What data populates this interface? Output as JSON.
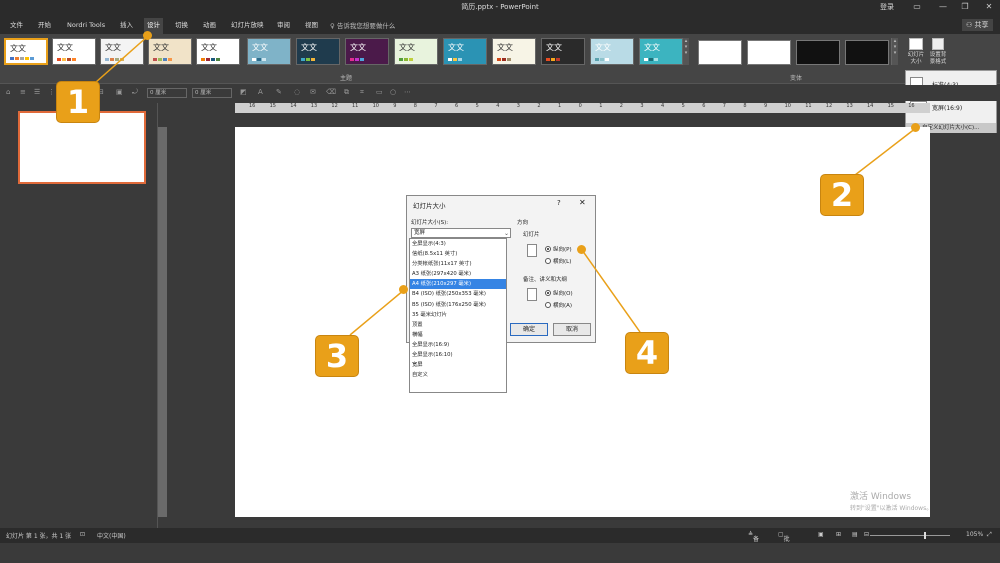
{
  "window": {
    "title": "简历.pptx - PowerPoint",
    "login": "登录"
  },
  "tabs": [
    {
      "label": "文件"
    },
    {
      "label": "开始"
    },
    {
      "label": "Nordri Tools"
    },
    {
      "label": "插入"
    },
    {
      "label": "设计"
    },
    {
      "label": "切换"
    },
    {
      "label": "动画"
    },
    {
      "label": "幻灯片放映"
    },
    {
      "label": "审阅"
    },
    {
      "label": "视图"
    }
  ],
  "tell_me": "告诉我您想要做什么",
  "share_label": "共享",
  "ribbon": {
    "theme_text": "文文",
    "themes_group_label": "主题",
    "variants_group_label": "变体",
    "slide_size_label": "幻灯片大小",
    "format_bg_label": "设置背景格式"
  },
  "size_menu": {
    "standard": "标准(4:3)",
    "wide": "宽屏(16:9)",
    "custom": "自定义幻灯片大小(C)..."
  },
  "toolbar": {
    "box1": "0 厘米",
    "box2": "0 厘米"
  },
  "ruler": [
    "16",
    "15",
    "14",
    "13",
    "12",
    "11",
    "10",
    "9",
    "8",
    "7",
    "6",
    "5",
    "4",
    "3",
    "2",
    "1",
    "0",
    "1",
    "2",
    "3",
    "4",
    "5",
    "6",
    "7",
    "8",
    "9",
    "10",
    "11",
    "12",
    "13",
    "14",
    "15",
    "16"
  ],
  "dialog": {
    "title": "幻灯片大小",
    "help": "?",
    "close": "✕",
    "size_label": "幻灯片大小(S):",
    "size_value": "宽屏",
    "orientation_label": "方向",
    "slide_label": "幻灯片",
    "portrait": "纵向(P)",
    "landscape": "横向(L)",
    "notes_label": "备注、讲义和大纲",
    "notes_portrait": "纵向(O)",
    "notes_landscape": "横向(A)",
    "ok": "确定",
    "cancel": "取消"
  },
  "size_options": [
    "全屏显示(4:3)",
    "信纸(8.5x11 英寸)",
    "分类帐纸张(11x17 英寸)",
    "A3 纸张(297x420 毫米)",
    "A4 纸张(210x297 毫米)",
    "B4 (ISO) 纸张(250x353 毫米)",
    "B5 (ISO) 纸张(176x250 毫米)",
    "35 毫米幻灯片",
    "顶置",
    "横幅",
    "全屏显示(16:9)",
    "全屏显示(16:10)",
    "宽屏",
    "自定义"
  ],
  "selected_option_index": 4,
  "watermark": {
    "line1": "激活 Windows",
    "line2": "转到\"设置\"以激活 Windows。"
  },
  "status": {
    "slide_count": "幻灯片 第 1 张，共 1 张",
    "language": "中文(中国)",
    "notes": "备注",
    "comments": "批注",
    "zoom": "105%"
  },
  "callouts": [
    "1",
    "2",
    "3",
    "4"
  ],
  "colors": {
    "accent": "#e9a019",
    "selection": "#3584e4",
    "thumb_border": "#e06a3a"
  }
}
